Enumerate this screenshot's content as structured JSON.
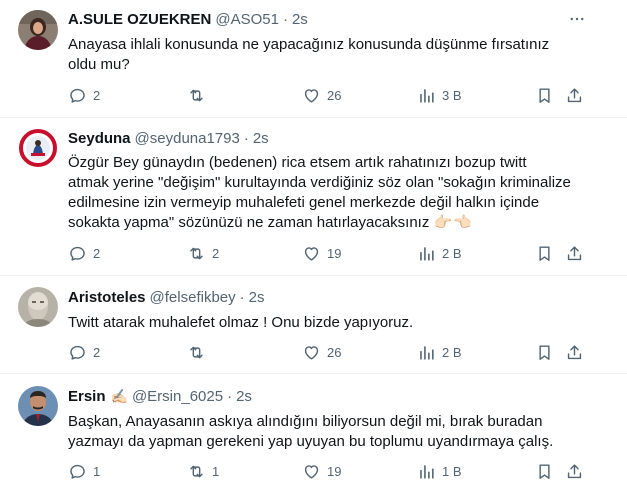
{
  "tweets": [
    {
      "name": "A.SULE OZUEKREN",
      "handle": "@ASO51",
      "dot": "·",
      "time": "2s",
      "avatar_icon": "profile-photo",
      "lines": [
        "Anayasa ihlali konusunda ne yapacağınız konusunda düşünme fırsatınız",
        "oldu mu?"
      ],
      "replies": "2",
      "retweets": "",
      "likes": "26",
      "views": "3 B"
    },
    {
      "name": "Seyduna",
      "handle": "@seyduna1793",
      "dot": "·",
      "time": "2s",
      "avatar_icon": "emblem-avatar",
      "lines": [
        "Özgür Bey günaydın (bedenen) rica etsem artık rahatınızı bozup twitt",
        "atmak yerine \"değişim\" kurultayında verdiğiniz söz olan \"sokağın kriminalize",
        "edilmesine izin vermeyip muhalefeti genel merkezde değil halkın içinde",
        "sokakta yapma\" sözünüzü ne zaman hatırlayacaksınız"
      ],
      "emoji": "👉🏻👈🏻",
      "replies": "2",
      "retweets": "2",
      "likes": "19",
      "views": "2 B"
    },
    {
      "name": "Aristoteles",
      "handle": "@felsefikbey",
      "dot": "·",
      "time": "2s",
      "avatar_icon": "statue-avatar",
      "lines": [
        "Twitt atarak muhalefet olmaz ! Onu bizde yapıyoruz."
      ],
      "replies": "2",
      "retweets": "",
      "likes": "26",
      "views": "2 B"
    },
    {
      "name": "Ersin",
      "name_emoji": "✍🏻",
      "handle": "@Ersin_6025",
      "dot": "·",
      "time": "2s",
      "avatar_icon": "profile-photo",
      "lines": [
        "Başkan, Anayasanın askıya alındığını biliyorsun değil mi, bırak buradan",
        "yazmayı da yapman gerekeni yap uyuyan bu toplumu uyandırmaya çalış."
      ],
      "replies": "1",
      "retweets": "1",
      "likes": "19",
      "views": "1 B"
    }
  ],
  "colors": {
    "text": "#0f1419",
    "secondary": "#536471",
    "divider": "#eff3f4"
  },
  "icons": [
    "reply-icon",
    "retweet-icon",
    "like-icon",
    "views-icon",
    "bookmark-icon",
    "share-icon",
    "more-icon"
  ]
}
